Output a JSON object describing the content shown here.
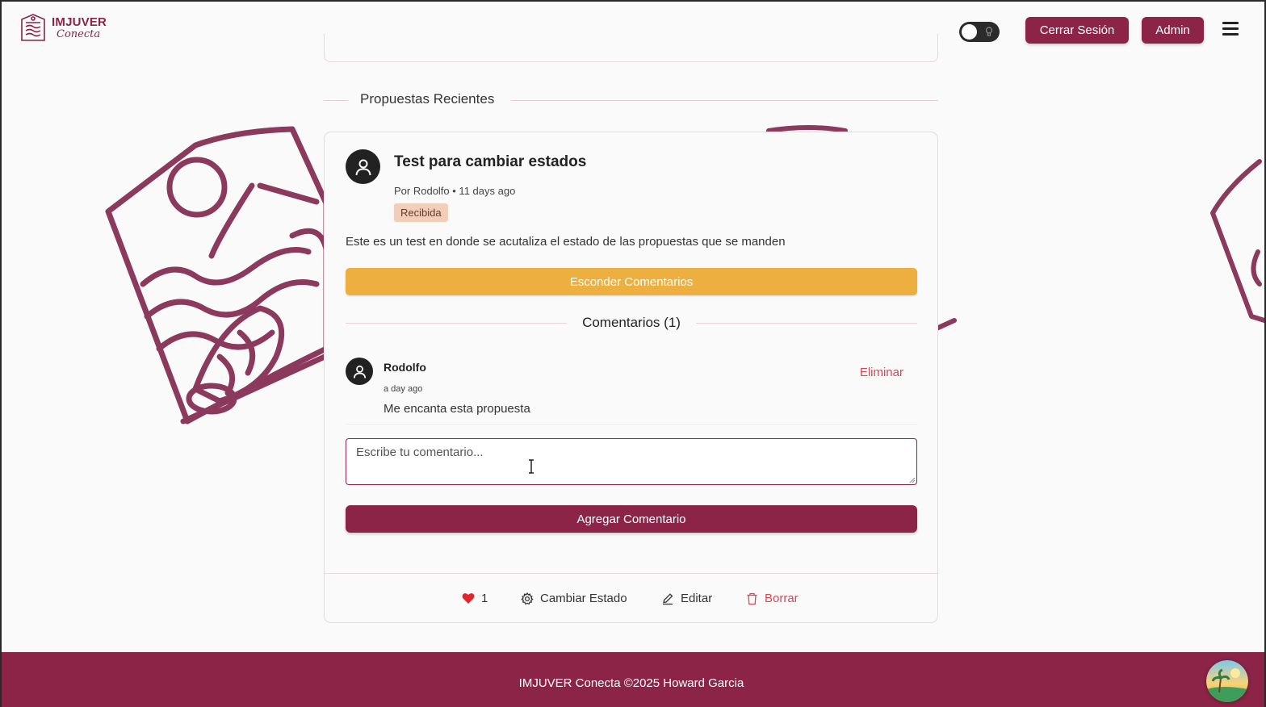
{
  "header": {
    "logo_line1": "IMJUVER",
    "logo_line2": "Conecta",
    "theme_toggle_state": "off",
    "logout_label": "Cerrar Sesión",
    "admin_label": "Admin",
    "menu_icon": "hamburger-icon"
  },
  "section": {
    "title": "Propuestas Recientes"
  },
  "proposal": {
    "title": "Test para cambiar estados",
    "meta": "Por Rodolfo • 11 days ago",
    "status": "Recibida",
    "body": "Este es un test en donde se acutaliza el estado de las propuestas que se manden",
    "toggle_comments_label": "Esconder Comentarios",
    "comments_title": "Comentarios (1)",
    "comments": [
      {
        "author": "Rodolfo",
        "time": "a day ago",
        "text": "Me encanta esta propuesta",
        "delete_label": "Eliminar"
      }
    ],
    "comment_placeholder": "Escribe tu comentario...",
    "add_comment_label": "Agregar Comentario",
    "likes": "1",
    "change_state_label": "Cambiar Estado",
    "edit_label": "Editar",
    "delete_label": "Borrar"
  },
  "footer": {
    "text": "IMJUVER Conecta ©2025 Howard Garcia"
  },
  "colors": {
    "brand": "#8b2447",
    "accent": "#edaf3f",
    "badge_bg": "#f2cdb8",
    "danger": "#d34a52",
    "like": "#e0252b"
  }
}
